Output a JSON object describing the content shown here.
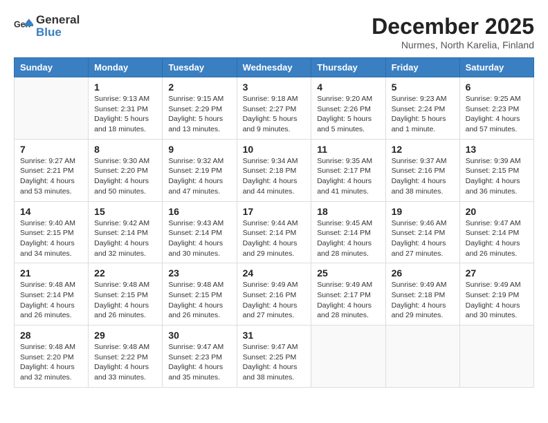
{
  "logo": {
    "general": "General",
    "blue": "Blue"
  },
  "header": {
    "month": "December 2025",
    "location": "Nurmes, North Karelia, Finland"
  },
  "weekdays": [
    "Sunday",
    "Monday",
    "Tuesday",
    "Wednesday",
    "Thursday",
    "Friday",
    "Saturday"
  ],
  "weeks": [
    [
      {
        "day": "",
        "info": ""
      },
      {
        "day": "1",
        "info": "Sunrise: 9:13 AM\nSunset: 2:31 PM\nDaylight: 5 hours\nand 18 minutes."
      },
      {
        "day": "2",
        "info": "Sunrise: 9:15 AM\nSunset: 2:29 PM\nDaylight: 5 hours\nand 13 minutes."
      },
      {
        "day": "3",
        "info": "Sunrise: 9:18 AM\nSunset: 2:27 PM\nDaylight: 5 hours\nand 9 minutes."
      },
      {
        "day": "4",
        "info": "Sunrise: 9:20 AM\nSunset: 2:26 PM\nDaylight: 5 hours\nand 5 minutes."
      },
      {
        "day": "5",
        "info": "Sunrise: 9:23 AM\nSunset: 2:24 PM\nDaylight: 5 hours\nand 1 minute."
      },
      {
        "day": "6",
        "info": "Sunrise: 9:25 AM\nSunset: 2:23 PM\nDaylight: 4 hours\nand 57 minutes."
      }
    ],
    [
      {
        "day": "7",
        "info": "Sunrise: 9:27 AM\nSunset: 2:21 PM\nDaylight: 4 hours\nand 53 minutes."
      },
      {
        "day": "8",
        "info": "Sunrise: 9:30 AM\nSunset: 2:20 PM\nDaylight: 4 hours\nand 50 minutes."
      },
      {
        "day": "9",
        "info": "Sunrise: 9:32 AM\nSunset: 2:19 PM\nDaylight: 4 hours\nand 47 minutes."
      },
      {
        "day": "10",
        "info": "Sunrise: 9:34 AM\nSunset: 2:18 PM\nDaylight: 4 hours\nand 44 minutes."
      },
      {
        "day": "11",
        "info": "Sunrise: 9:35 AM\nSunset: 2:17 PM\nDaylight: 4 hours\nand 41 minutes."
      },
      {
        "day": "12",
        "info": "Sunrise: 9:37 AM\nSunset: 2:16 PM\nDaylight: 4 hours\nand 38 minutes."
      },
      {
        "day": "13",
        "info": "Sunrise: 9:39 AM\nSunset: 2:15 PM\nDaylight: 4 hours\nand 36 minutes."
      }
    ],
    [
      {
        "day": "14",
        "info": "Sunrise: 9:40 AM\nSunset: 2:15 PM\nDaylight: 4 hours\nand 34 minutes."
      },
      {
        "day": "15",
        "info": "Sunrise: 9:42 AM\nSunset: 2:14 PM\nDaylight: 4 hours\nand 32 minutes."
      },
      {
        "day": "16",
        "info": "Sunrise: 9:43 AM\nSunset: 2:14 PM\nDaylight: 4 hours\nand 30 minutes."
      },
      {
        "day": "17",
        "info": "Sunrise: 9:44 AM\nSunset: 2:14 PM\nDaylight: 4 hours\nand 29 minutes."
      },
      {
        "day": "18",
        "info": "Sunrise: 9:45 AM\nSunset: 2:14 PM\nDaylight: 4 hours\nand 28 minutes."
      },
      {
        "day": "19",
        "info": "Sunrise: 9:46 AM\nSunset: 2:14 PM\nDaylight: 4 hours\nand 27 minutes."
      },
      {
        "day": "20",
        "info": "Sunrise: 9:47 AM\nSunset: 2:14 PM\nDaylight: 4 hours\nand 26 minutes."
      }
    ],
    [
      {
        "day": "21",
        "info": "Sunrise: 9:48 AM\nSunset: 2:14 PM\nDaylight: 4 hours\nand 26 minutes."
      },
      {
        "day": "22",
        "info": "Sunrise: 9:48 AM\nSunset: 2:15 PM\nDaylight: 4 hours\nand 26 minutes."
      },
      {
        "day": "23",
        "info": "Sunrise: 9:48 AM\nSunset: 2:15 PM\nDaylight: 4 hours\nand 26 minutes."
      },
      {
        "day": "24",
        "info": "Sunrise: 9:49 AM\nSunset: 2:16 PM\nDaylight: 4 hours\nand 27 minutes."
      },
      {
        "day": "25",
        "info": "Sunrise: 9:49 AM\nSunset: 2:17 PM\nDaylight: 4 hours\nand 28 minutes."
      },
      {
        "day": "26",
        "info": "Sunrise: 9:49 AM\nSunset: 2:18 PM\nDaylight: 4 hours\nand 29 minutes."
      },
      {
        "day": "27",
        "info": "Sunrise: 9:49 AM\nSunset: 2:19 PM\nDaylight: 4 hours\nand 30 minutes."
      }
    ],
    [
      {
        "day": "28",
        "info": "Sunrise: 9:48 AM\nSunset: 2:20 PM\nDaylight: 4 hours\nand 32 minutes."
      },
      {
        "day": "29",
        "info": "Sunrise: 9:48 AM\nSunset: 2:22 PM\nDaylight: 4 hours\nand 33 minutes."
      },
      {
        "day": "30",
        "info": "Sunrise: 9:47 AM\nSunset: 2:23 PM\nDaylight: 4 hours\nand 35 minutes."
      },
      {
        "day": "31",
        "info": "Sunrise: 9:47 AM\nSunset: 2:25 PM\nDaylight: 4 hours\nand 38 minutes."
      },
      {
        "day": "",
        "info": ""
      },
      {
        "day": "",
        "info": ""
      },
      {
        "day": "",
        "info": ""
      }
    ]
  ]
}
